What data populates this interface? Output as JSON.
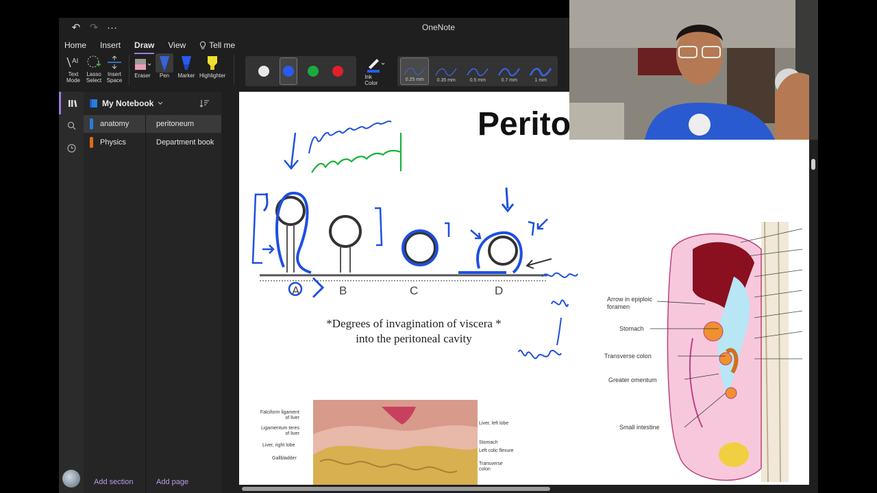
{
  "app": {
    "title": "OneNote",
    "quick_access": {
      "undo": "↶",
      "redo": "↷",
      "more": "···"
    }
  },
  "menu": {
    "tabs": [
      "Home",
      "Insert",
      "Draw",
      "View"
    ],
    "active": "Draw",
    "tell_me": "Tell me"
  },
  "ribbon": {
    "text_mode": "Text Mode",
    "lasso_select": "Lasso Select",
    "insert_space": "Insert Space",
    "eraser": "Eraser",
    "pen": "Pen",
    "marker": "Marker",
    "highlighter": "Highlighter",
    "ink_color": "Ink Color",
    "swatches": [
      "#e8e8e8",
      "#2a5bf0",
      "#1aab3e",
      "#e0202a"
    ],
    "thickness": [
      "0.25 mm",
      "0.35 mm",
      "0.5 mm",
      "0.7 mm",
      "1 mm"
    ]
  },
  "notebook": {
    "name": "My Notebook",
    "sections": [
      {
        "label": "anatomy",
        "color": "#2a7be0"
      },
      {
        "label": "Physics",
        "color": "#e06a1a"
      }
    ],
    "pages": [
      "peritoneum",
      "Department book"
    ],
    "add_section": "Add section",
    "add_page": "Add page"
  },
  "canvas": {
    "title": "Perito",
    "caption_line1": "*Degrees of invagination of viscera *",
    "caption_line2": "into the peritoneal cavity",
    "diagram_letters": [
      "A",
      "B",
      "C",
      "D"
    ],
    "sagittal_labels": [
      "Arrow in epiploic foramen",
      "Stomach",
      "Transverse colon",
      "Greater omentum",
      "Small intestine"
    ],
    "anatomy_left_labels": [
      "Falciform ligament of liver",
      "Ligamentum teres of liver",
      "Liver, right lobe",
      "Gallbladder"
    ],
    "anatomy_right_labels": [
      "Liver, left lobe",
      "Stomach",
      "Left colic flexure",
      "Transverse colon"
    ]
  }
}
